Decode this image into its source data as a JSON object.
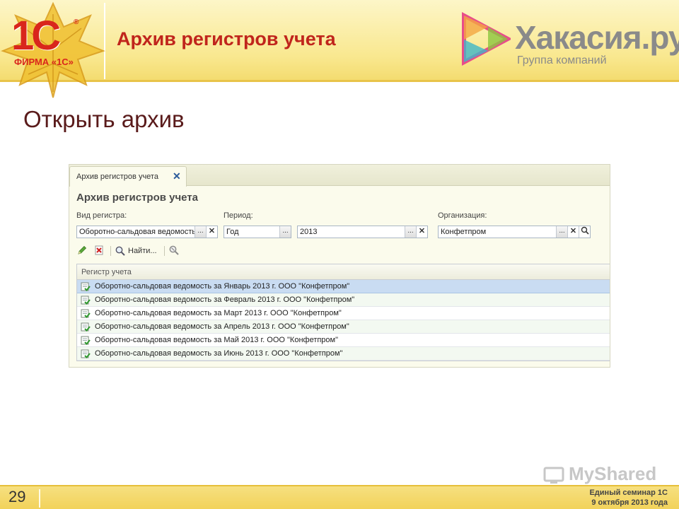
{
  "slide": {
    "logo_main": "1С",
    "logo_reg": "®",
    "logo_caption": "ФИРМА «1С»",
    "title": "Архив регистров учета",
    "partner_name": "Хакасия.ру",
    "partner_sub": "Группа компаний",
    "subtitle": "Открыть архив",
    "page_number": "29",
    "footer_line1": "Единый семинар 1С",
    "footer_line2": "9 октября 2013 года",
    "watermark": "MyShared"
  },
  "window": {
    "tab_label": "Архив регистров учета",
    "tab_close": "✕",
    "form_title": "Архив регистров учета",
    "fields": {
      "register_type": {
        "label": "Вид регистра:",
        "value": "Оборотно-сальдовая ведомость"
      },
      "period": {
        "label": "Период:",
        "value": "Год"
      },
      "year": {
        "value": "2013"
      },
      "organization": {
        "label": "Организация:",
        "value": "Конфетпром"
      }
    },
    "button_glyphs": {
      "select": "...",
      "clear": "✕"
    },
    "toolbar": {
      "find_label": "Найти..."
    },
    "table": {
      "header": "Регистр учета",
      "rows": [
        "Оборотно-сальдовая ведомость за Январь 2013 г. ООО \"Конфетпром\"",
        "Оборотно-сальдовая ведомость за Февраль 2013 г. ООО \"Конфетпром\"",
        "Оборотно-сальдовая ведомость за Март 2013 г. ООО \"Конфетпром\"",
        "Оборотно-сальдовая ведомость за Апрель 2013 г. ООО \"Конфетпром\"",
        "Оборотно-сальдовая ведомость за Май 2013 г. ООО \"Конфетпром\"",
        "Оборотно-сальдовая ведомость за Июнь 2013 г. ООО \"Конфетпром\""
      ],
      "selected_row": 0
    }
  },
  "colors": {
    "brand_red": "#c0251c",
    "header_yellow": "#f9e890",
    "selection_blue": "#c9dcf2"
  }
}
